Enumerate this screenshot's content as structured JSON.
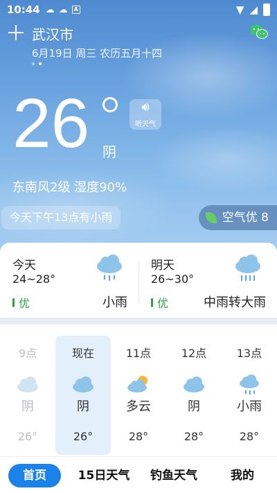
{
  "statusbar": {
    "time": "10:44"
  },
  "header": {
    "city": "武汉市",
    "date": "6月19日 周三 农历五月十四"
  },
  "current": {
    "temperature": "26",
    "condition": "阴",
    "listen_label": "听天气",
    "wind_humidity": "东南风2级 湿度90%",
    "rain_note": "今天下午13点有小雨",
    "aqi": "空气优 8"
  },
  "forecast": {
    "today": {
      "day": "今天",
      "range": "24~28°",
      "air": "优",
      "condition": "小雨"
    },
    "tomorrow": {
      "day": "明天",
      "range": "26~30°",
      "air": "优",
      "condition": "中雨转大雨"
    }
  },
  "hourly": [
    {
      "label": "9点",
      "condition": "阴",
      "temp": "26°",
      "icon": "cloudy-icon"
    },
    {
      "label": "现在",
      "condition": "阴",
      "temp": "26°",
      "icon": "cloudy-icon"
    },
    {
      "label": "11点",
      "condition": "多云",
      "temp": "28°",
      "icon": "partly-cloudy-icon"
    },
    {
      "label": "12点",
      "condition": "阴",
      "temp": "28°",
      "icon": "cloudy-icon"
    },
    {
      "label": "13点",
      "condition": "小雨",
      "temp": "28°",
      "icon": "light-rain-icon"
    }
  ],
  "tabs": [
    {
      "label": "首页"
    },
    {
      "label": "15日天气"
    },
    {
      "label": "钓鱼天气"
    },
    {
      "label": "我的"
    }
  ],
  "colors": {
    "accent": "#1a82ea",
    "air_good": "#2ca14a"
  }
}
